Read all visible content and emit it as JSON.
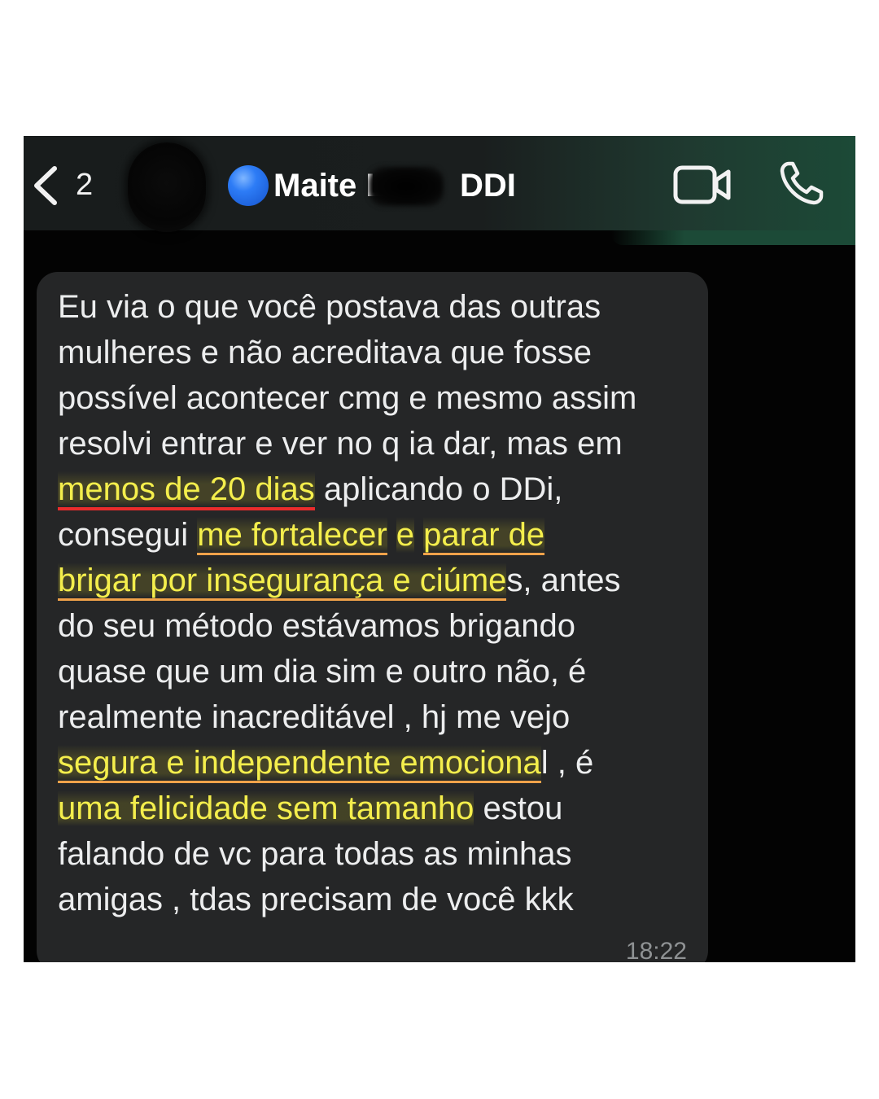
{
  "header": {
    "unread_count": "2",
    "contact_name": "Maite",
    "contact_name_obscured": "L",
    "contact_suffix": "DDI"
  },
  "message": {
    "lines": [
      "Eu via o que você postava das outras",
      "mulheres e não acreditava que fosse",
      "possível acontecer cmg e mesmo assim",
      "resolvi entrar e ver no q ia dar, mas em",
      "aplicando o DDi,",
      "consegui",
      "e",
      "s, antes",
      "do seu método estávamos brigando",
      "quase que um dia sim e outro não, é",
      "realmente inacreditável , hj me vejo",
      "l , é",
      "estou",
      "falando de vc para todas as minhas",
      "amigas , tdas precisam de você kkk"
    ],
    "highlights": {
      "h1": "menos de 20 dias",
      "h2": "me fortalecer",
      "h3": "parar de",
      "h4": "brigar por insegurança e ciúme",
      "h5": "segura e independente emociona",
      "h6": "uma felicidade sem tamanho"
    },
    "time": "18:22"
  },
  "colors": {
    "bubble": "#252627",
    "highlight_text": "#f4ee4c",
    "accent_green": "#1c4a37",
    "blue_dot": "#2d7cf6"
  },
  "icons": [
    "back-chevron-icon",
    "video-camera-icon",
    "phone-icon"
  ]
}
